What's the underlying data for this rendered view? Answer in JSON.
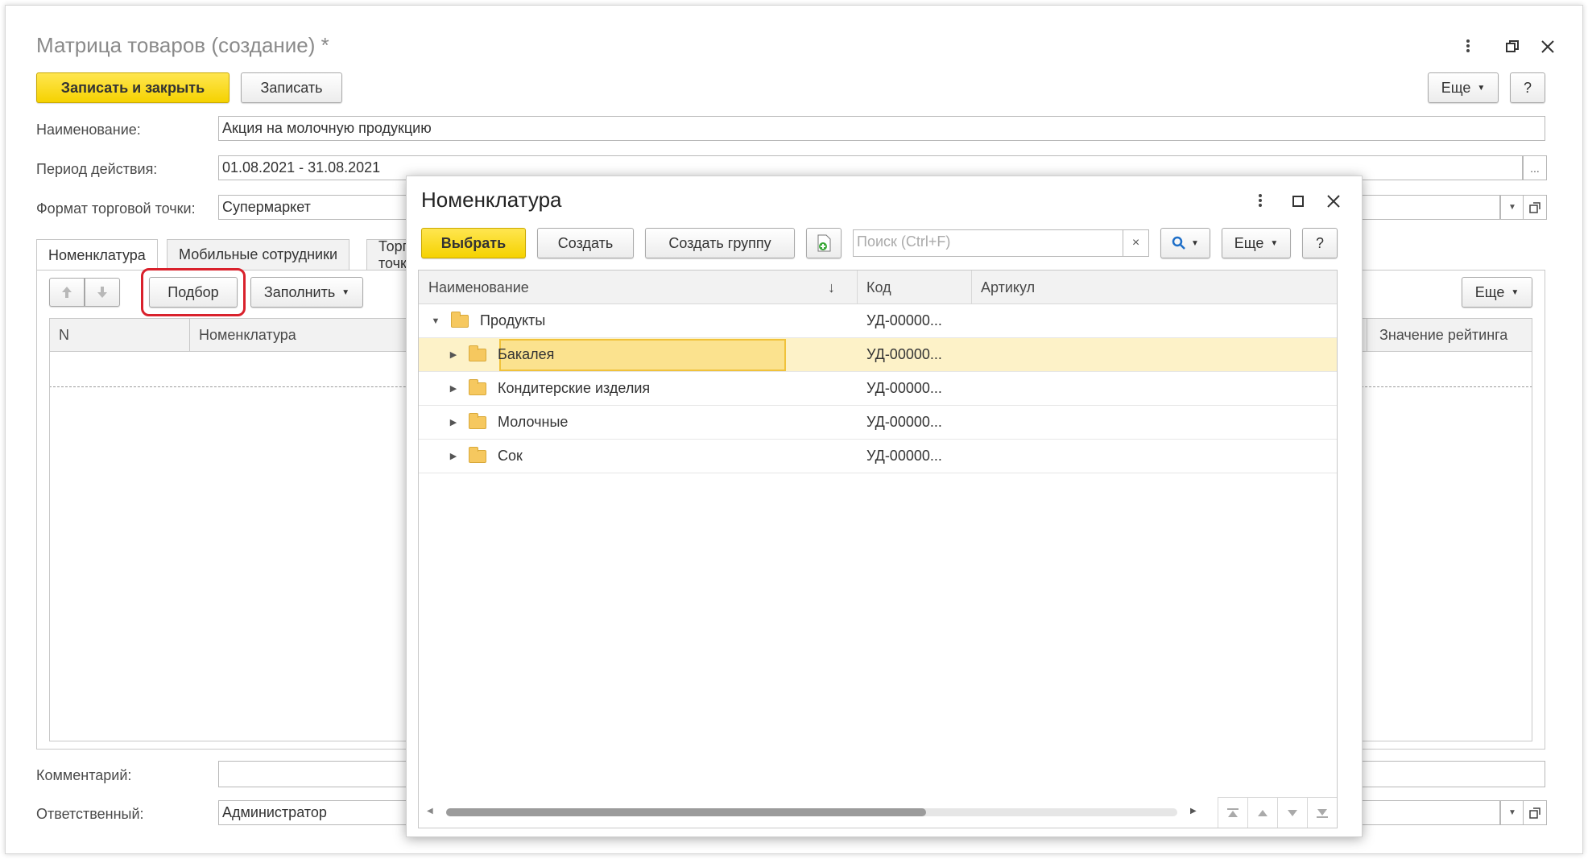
{
  "window": {
    "title": "Матрица товаров (создание) *"
  },
  "toolbar": {
    "save_close": "Записать и закрыть",
    "save": "Записать",
    "more": "Еще",
    "help": "?"
  },
  "form": {
    "name_label": "Наименование:",
    "name_value": "Акция на молочную продукцию",
    "period_label": "Период действия:",
    "period_value": "01.08.2021 - 31.08.2021",
    "format_label": "Формат торговой точки:",
    "format_value": "Супермаркет",
    "comment_label": "Комментарий:",
    "comment_value": "",
    "responsible_label": "Ответственный:",
    "responsible_value": "Администратор",
    "ellipsis": "..."
  },
  "tabs": [
    "Номенклатура",
    "Мобильные сотрудники",
    "Торговые точки"
  ],
  "tab_toolbar": {
    "select": "Подбор",
    "fill": "Заполнить",
    "more": "Еще"
  },
  "table": {
    "columns": [
      "N",
      "Номенклатура",
      "Значение рейтинга"
    ]
  },
  "dialog": {
    "title": "Номенклатура",
    "choose": "Выбрать",
    "create": "Создать",
    "create_group": "Создать группу",
    "search_placeholder": "Поиск (Ctrl+F)",
    "clear": "×",
    "more": "Еще",
    "help": "?",
    "columns": {
      "name": "Наименование",
      "sort": "↓",
      "code": "Код",
      "article": "Артикул"
    },
    "rows": [
      {
        "name": "Продукты",
        "code": "УД-00000...",
        "article": ""
      },
      {
        "name": "Бакалея",
        "code": "УД-00000...",
        "article": ""
      },
      {
        "name": "Кондитерские изделия",
        "code": "УД-00000...",
        "article": ""
      },
      {
        "name": "Молочные",
        "code": "УД-00000...",
        "article": ""
      },
      {
        "name": "Сок",
        "code": "УД-00000...",
        "article": ""
      }
    ]
  },
  "colors": {
    "accent_yellow": "#f5d200",
    "selected_row": "#fdf2c8",
    "highlight_red": "#d9212c"
  }
}
